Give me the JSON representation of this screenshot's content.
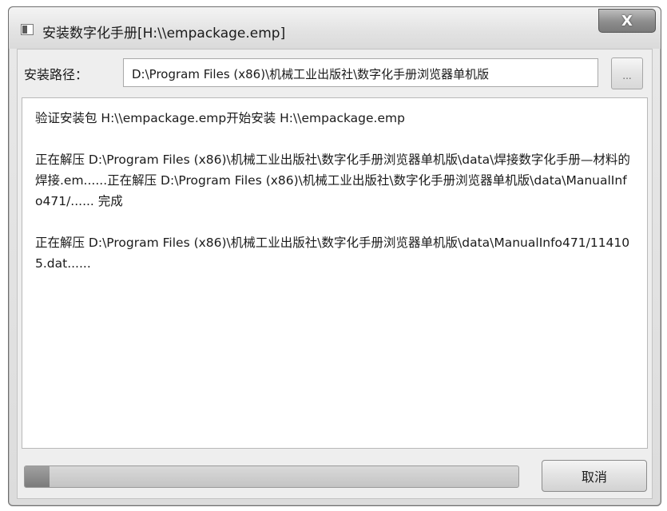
{
  "window": {
    "title": "安装数字化手册[H:\\\\empackage.emp]",
    "close_label": "X"
  },
  "path": {
    "label": "安装路径：",
    "value": "D:\\Program Files (x86)\\机械工业出版社\\数字化手册浏览器单机版",
    "browse_label": "..."
  },
  "log": {
    "lines": [
      "验证安装包 H:\\\\empackage.emp开始安装 H:\\\\empackage.emp",
      "正在解压 D:\\Program Files (x86)\\机械工业出版社\\数字化手册浏览器单机版\\data\\焊接数字化手册—材料的焊接.em......正在解压 D:\\Program Files (x86)\\机械工业出版社\\数字化手册浏览器单机版\\data\\ManualInfo471/...... 完成",
      "正在解压 D:\\Program Files (x86)\\机械工业出版社\\数字化手册浏览器单机版\\data\\ManualInfo471/114105.dat......"
    ]
  },
  "progress": {
    "fraction": 0.05
  },
  "buttons": {
    "cancel_label": "取消"
  },
  "icons": {
    "app": "window-app-icon",
    "close": "close-icon"
  }
}
